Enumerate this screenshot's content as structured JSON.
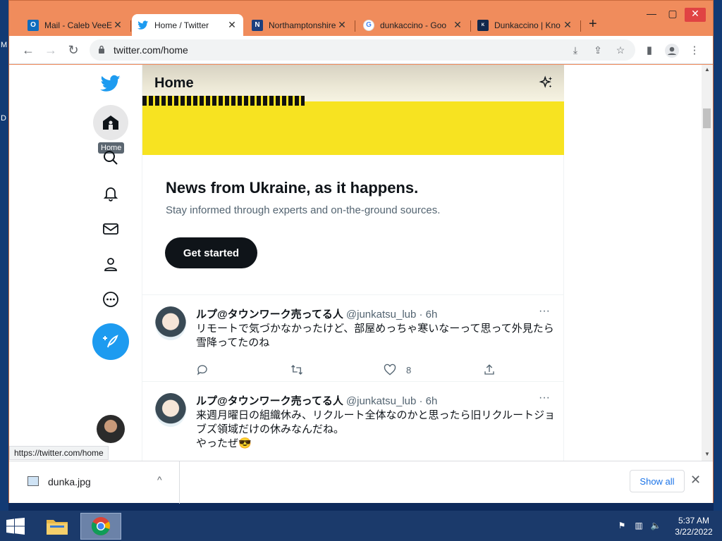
{
  "desktop": {
    "left_letters": [
      "M",
      "D"
    ]
  },
  "window_controls": {
    "minimize": "—",
    "maximize": "▢",
    "close": "✕"
  },
  "tabs": [
    {
      "title": "Mail - Caleb VeeE",
      "favicon": "outlook-icon",
      "color": "#0f6cbd"
    },
    {
      "title": "Home / Twitter",
      "favicon": "twitter-bird-icon",
      "color": "#1d9bf0",
      "active": true
    },
    {
      "title": "Northamptonshire",
      "favicon": "n-logo-icon",
      "color": "#1c3f7e"
    },
    {
      "title": "dunkaccino - Goo",
      "favicon": "google-icon",
      "color": "#4285f4"
    },
    {
      "title": "Dunkaccino | Kno",
      "favicon": "kym-icon",
      "color": "#12284c"
    }
  ],
  "new_tab_label": "+",
  "address_bar": {
    "url": "twitter.com/home"
  },
  "twitter": {
    "tooltip": "Home",
    "header": {
      "title": "Home"
    },
    "promo": {
      "headline": "News from Ukraine, as it happens.",
      "subtitle": "Stay informed through experts and on-the-ground sources.",
      "button": "Get started"
    },
    "tweets": [
      {
        "name": "ルプ@タウンワーク売ってる人",
        "handle": "@junkatsu_lub · 6h",
        "text": "リモートで気づかなかったけど、部屋めっちゃ寒いなーって思って外見たら雪降ってたのね",
        "likes": "8"
      },
      {
        "name": "ルプ@タウンワーク売ってる人",
        "handle": "@junkatsu_lub · 6h",
        "text": "来週月曜日の組織休み、リクルート全体なのかと思ったら旧リクルートジョブズ領域だけの休みなんだね。",
        "text2": "やったぜ😎",
        "likes": ""
      }
    ],
    "more_glyph": "···"
  },
  "status_bar": {
    "url": "https://twitter.com/home"
  },
  "downloads": {
    "file_name": "dunka.jpg",
    "show_all": "Show all",
    "close": "✕",
    "chevron": "^"
  },
  "taskbar": {
    "time": "5:37 AM",
    "date": "3/22/2022"
  }
}
